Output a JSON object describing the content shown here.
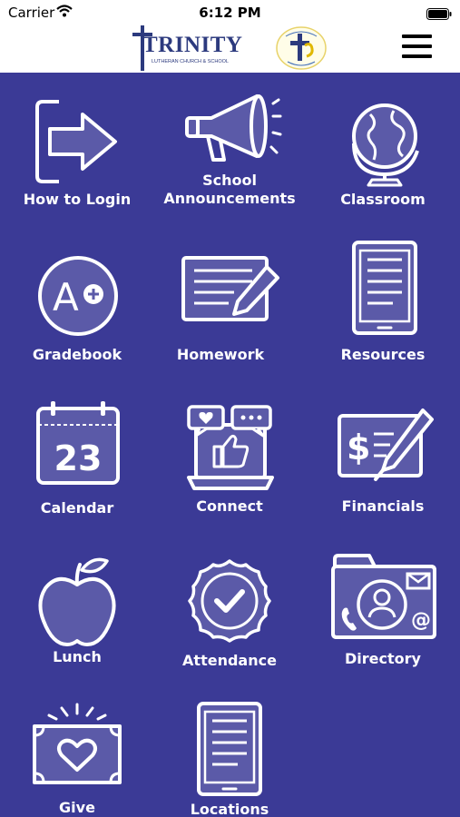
{
  "status_bar": {
    "carrier": "Carrier",
    "time": "6:12 PM"
  },
  "header": {
    "logo_word": "TRINITY",
    "logo_subtitle": "LUTHERAN CHURCH & SCHOOL",
    "seal_icon": "christ-centered-child-focused-seal",
    "menu_icon": "hamburger-menu-icon"
  },
  "colors": {
    "background": "#3b3a96",
    "icon_fill": "#5b5aa8",
    "header": "#ffffff",
    "brand_navy": "#2c3a7e"
  },
  "tiles": [
    {
      "label": "How to Login",
      "icon": "login-arrow-icon"
    },
    {
      "label": "School\nAnnouncements",
      "icon": "megaphone-icon"
    },
    {
      "label": "Classroom",
      "icon": "globe-icon"
    },
    {
      "label": "Gradebook",
      "icon": "grade-a-plus-icon"
    },
    {
      "label": "Homework",
      "icon": "notepad-pencil-icon"
    },
    {
      "label": "Resources",
      "icon": "tablet-document-icon"
    },
    {
      "label": "Calendar",
      "icon": "calendar-icon",
      "icon_text": "23"
    },
    {
      "label": "Connect",
      "icon": "social-laptop-icon"
    },
    {
      "label": "Financials",
      "icon": "check-pen-icon",
      "icon_text": "$"
    },
    {
      "label": "Lunch",
      "icon": "apple-icon"
    },
    {
      "label": "Attendance",
      "icon": "check-badge-icon"
    },
    {
      "label": "Directory",
      "icon": "contact-folder-icon",
      "icon_text": "@"
    },
    {
      "label": "Give",
      "icon": "heart-bill-icon"
    },
    {
      "label": "Locations",
      "icon": "tablet-document-icon"
    }
  ]
}
